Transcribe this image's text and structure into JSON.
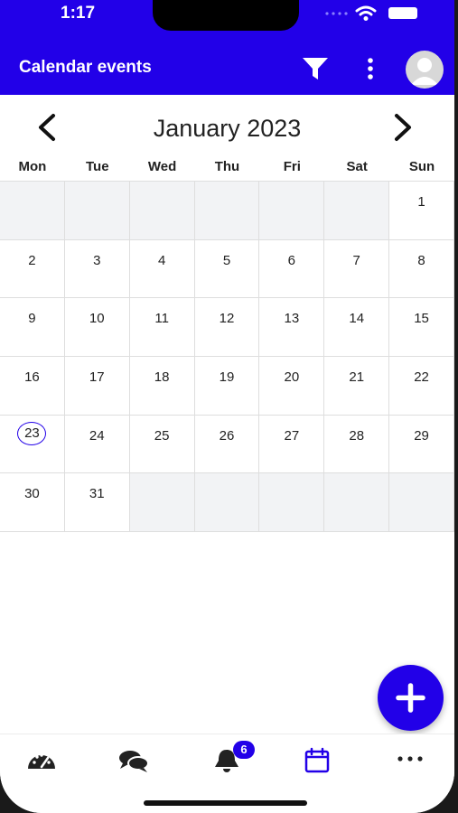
{
  "status_bar": {
    "time": "1:17"
  },
  "header": {
    "title": "Calendar events",
    "accent_color": "#2200e8",
    "icons": [
      "filter-icon",
      "more-vertical-icon",
      "avatar"
    ]
  },
  "calendar": {
    "month_label": "January 2023",
    "weekdays": [
      "Mon",
      "Tue",
      "Wed",
      "Thu",
      "Fri",
      "Sat",
      "Sun"
    ],
    "days": [
      "",
      "",
      "",
      "",
      "",
      "",
      "1",
      "2",
      "3",
      "4",
      "5",
      "6",
      "7",
      "8",
      "9",
      "10",
      "11",
      "12",
      "13",
      "14",
      "15",
      "16",
      "17",
      "18",
      "19",
      "20",
      "21",
      "22",
      "23",
      "24",
      "25",
      "26",
      "27",
      "28",
      "29",
      "30",
      "31",
      "",
      "",
      "",
      "",
      ""
    ],
    "today": "23"
  },
  "fab": {
    "icon": "plus-icon"
  },
  "tabbar": {
    "tabs": [
      {
        "name": "dashboard",
        "icon": "speedometer-icon"
      },
      {
        "name": "chat",
        "icon": "chat-bubbles-icon"
      },
      {
        "name": "notifications",
        "icon": "bell-icon",
        "badge": "6"
      },
      {
        "name": "calendar",
        "icon": "calendar-icon",
        "active": true
      },
      {
        "name": "more",
        "icon": "more-horizontal-icon"
      }
    ],
    "notification_badge": "6"
  }
}
